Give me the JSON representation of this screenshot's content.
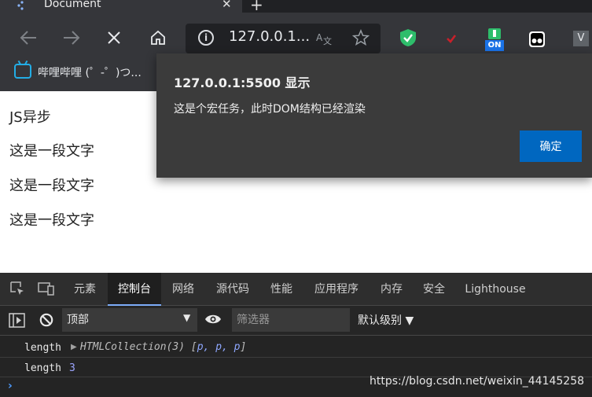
{
  "browser": {
    "tab_title": "Document",
    "tab_close": "✕",
    "new_tab": "+",
    "address": "127.0.0.1...",
    "bookmark_label": "哔哩哔哩 (゜-゜)つ..."
  },
  "extensions": {
    "on_badge": "ON",
    "v_letter": "V"
  },
  "page": {
    "heading": "JS异步",
    "paragraphs": [
      "这是一段文字",
      "这是一段文字",
      "这是一段文字"
    ]
  },
  "dialog": {
    "title": "127.0.0.1:5500 显示",
    "message": "这是个宏任务，此时DOM结构已经渲染",
    "ok_label": "确定"
  },
  "devtools": {
    "tabs": [
      {
        "label": "元素"
      },
      {
        "label": "控制台"
      },
      {
        "label": "网络"
      },
      {
        "label": "源代码"
      },
      {
        "label": "性能"
      },
      {
        "label": "应用程序"
      },
      {
        "label": "内存"
      },
      {
        "label": "安全"
      },
      {
        "label": "Lighthouse"
      }
    ],
    "context": "顶部",
    "filter_placeholder": "筛选器",
    "levels": "默认级别 ▼",
    "console": [
      {
        "key": "length",
        "value": "HTMLCollection(3) [",
        "items": "p, p, p",
        "close": "]"
      },
      {
        "key": "length",
        "number": "3"
      }
    ],
    "prompt": "›"
  },
  "watermark": "https://blog.csdn.net/weixin_44145258",
  "colors": {
    "dialog_button": "#0067c0",
    "console_number": "#9da6ff",
    "active_tab_underline": "#7cacf8"
  }
}
